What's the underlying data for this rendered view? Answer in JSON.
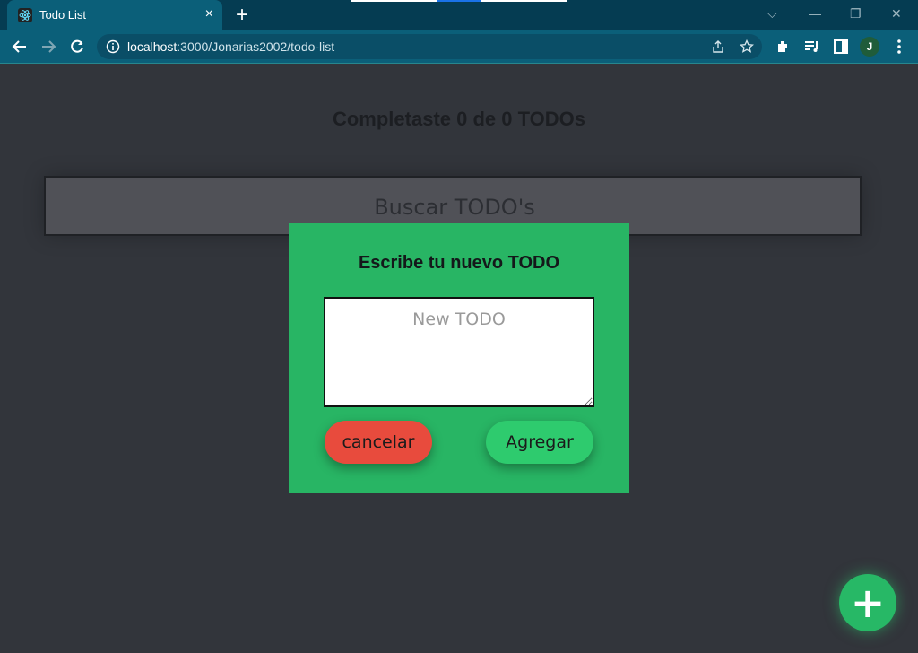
{
  "browser": {
    "tab": {
      "title": "Todo List",
      "close_glyph": "×"
    },
    "new_tab_glyph": "+",
    "window_controls": {
      "dropdown": "⌵",
      "minimize": "—",
      "restore": "❐",
      "close": "✕"
    },
    "url": {
      "host": "localhost",
      "rest": ":3000/Jonarias2002/todo-list"
    },
    "profile_initial": "J",
    "icons": [
      "back-arrow-icon",
      "forward-arrow-icon",
      "reload-icon",
      "info-icon",
      "share-icon",
      "star-icon",
      "extensions-icon",
      "media-icon",
      "sidebar-icon",
      "menu-dots-icon"
    ]
  },
  "app": {
    "counter_title": "Completaste 0 de 0 TODOs",
    "search": {
      "placeholder": "Buscar TODO's"
    },
    "modal": {
      "title": "Escribe tu nuevo TODO",
      "textarea_placeholder": "New TODO",
      "cancel_label": "cancelar",
      "add_label": "Agregar"
    },
    "fab_label": "+"
  },
  "colors": {
    "page_bg": "#32353b",
    "modal_bg": "#28b564",
    "cancel_button": "#e84b3d",
    "add_button": "#2ecb6e",
    "browser_frame": "#0b5f79"
  }
}
